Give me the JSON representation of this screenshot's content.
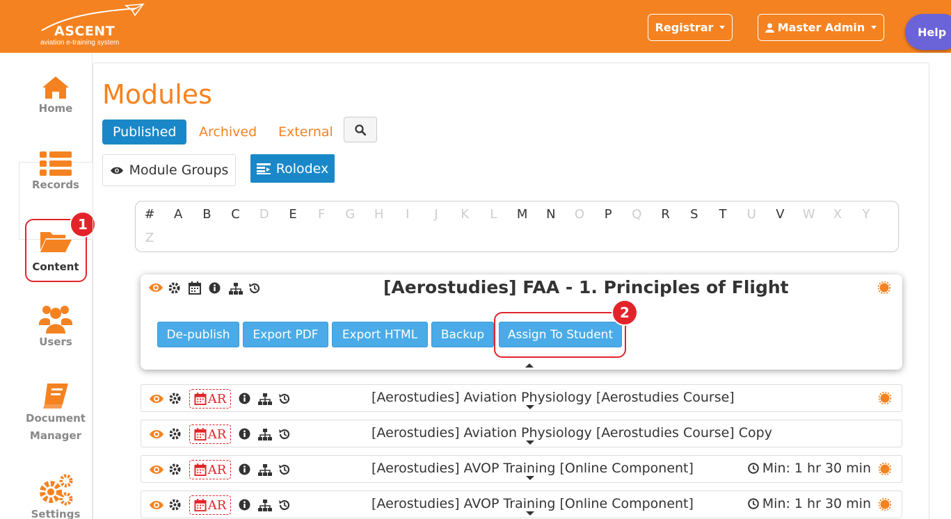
{
  "header": {
    "logo_text": "ASCENT",
    "logo_subtitle": "aviation e-training system",
    "registrar_label": "Registrar",
    "user_label": "Master Admin",
    "help_label": "Help"
  },
  "sidebar": {
    "items": [
      {
        "label": "Home",
        "icon": "home-icon"
      },
      {
        "label": "Records",
        "icon": "list-icon"
      },
      {
        "label": "Content",
        "icon": "folder-open-icon"
      },
      {
        "label": "Users",
        "icon": "users-icon"
      },
      {
        "label_line1": "Document",
        "label_line2": "Manager",
        "icon": "book-icon"
      },
      {
        "label": "Settings",
        "icon": "gears-icon"
      }
    ]
  },
  "annotations": {
    "badge1": "1",
    "badge2": "2"
  },
  "main": {
    "title": "Modules",
    "tabs": [
      {
        "label": "Published",
        "active": true
      },
      {
        "label": "Archived",
        "active": false
      },
      {
        "label": "External",
        "active": false
      }
    ],
    "module_groups_label": "Module Groups",
    "rolodex_label": "Rolodex",
    "alphabet": [
      {
        "ch": "#",
        "on": true
      },
      {
        "ch": "A",
        "on": true
      },
      {
        "ch": "B",
        "on": true
      },
      {
        "ch": "C",
        "on": true
      },
      {
        "ch": "D",
        "on": false
      },
      {
        "ch": "E",
        "on": true
      },
      {
        "ch": "F",
        "on": false
      },
      {
        "ch": "G",
        "on": false
      },
      {
        "ch": "H",
        "on": false
      },
      {
        "ch": "I",
        "on": false
      },
      {
        "ch": "J",
        "on": false
      },
      {
        "ch": "K",
        "on": false
      },
      {
        "ch": "L",
        "on": false
      },
      {
        "ch": "M",
        "on": true
      },
      {
        "ch": "N",
        "on": true
      },
      {
        "ch": "O",
        "on": false
      },
      {
        "ch": "P",
        "on": true
      },
      {
        "ch": "Q",
        "on": false
      },
      {
        "ch": "R",
        "on": true
      },
      {
        "ch": "S",
        "on": true
      },
      {
        "ch": "T",
        "on": true
      },
      {
        "ch": "U",
        "on": false
      },
      {
        "ch": "V",
        "on": true
      },
      {
        "ch": "W",
        "on": false
      },
      {
        "ch": "X",
        "on": false
      },
      {
        "ch": "Y",
        "on": false
      },
      {
        "ch": "Z",
        "on": false
      }
    ],
    "expanded": {
      "title": "[Aerostudies] FAA - 1. Principles of Flight",
      "actions": [
        "De-publish",
        "Export PDF",
        "Export HTML",
        "Backup",
        "Assign To Student"
      ]
    },
    "rows": [
      {
        "title": "[Aerostudies] Aviation Physiology [Aerostudies Course]",
        "ar": "AR",
        "duration": "",
        "status": true
      },
      {
        "title": "[Aerostudies] Aviation Physiology [Aerostudies Course] Copy",
        "ar": "AR",
        "duration": "",
        "status": false
      },
      {
        "title": "[Aerostudies] AVOP Training [Online Component]",
        "ar": "AR",
        "duration": "Min: 1 hr 30 min",
        "status": true
      },
      {
        "title": "[Aerostudies] AVOP Training [Online Component]",
        "ar": "AR",
        "duration": "Min: 1 hr 30 min",
        "status": true
      }
    ]
  },
  "colors": {
    "brand": "#f58220",
    "primary": "#1a88c8",
    "action": "#4aabe8",
    "highlight": "#e3232a",
    "help": "#6b63d8"
  }
}
